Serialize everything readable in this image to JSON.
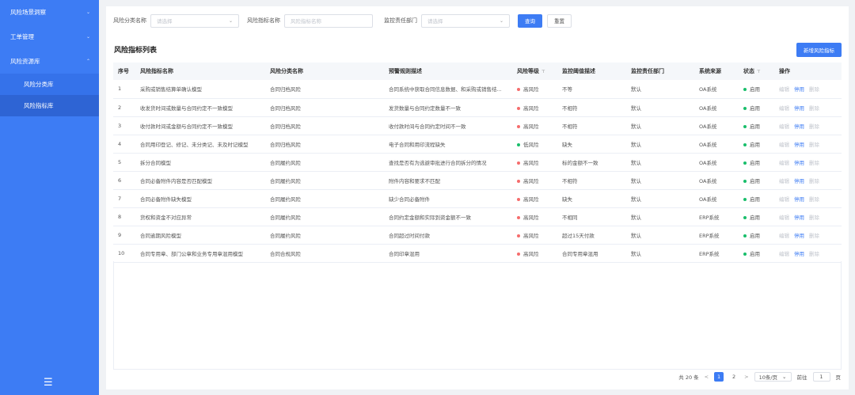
{
  "sidebar": {
    "items": [
      {
        "label": "风险场景洞察",
        "arrow": "⌄"
      },
      {
        "label": "工单管理",
        "arrow": "⌄"
      },
      {
        "label": "风险资源库",
        "arrow": "⌃"
      }
    ],
    "subitems": [
      {
        "label": "风险分类库"
      },
      {
        "label": "风险指标库"
      }
    ],
    "collapse_icon": "☰"
  },
  "filters": {
    "category_label": "风险分类名称",
    "category_placeholder": "请选择",
    "indicator_label": "风险指标名称",
    "indicator_placeholder": "风险指标名称",
    "dept_label": "监控责任部门",
    "dept_placeholder": "请选择",
    "query_button": "查询",
    "reset_button": "重置"
  },
  "section": {
    "title": "风险指标列表",
    "add_button": "新增风险指标"
  },
  "table": {
    "headers": [
      "序号",
      "风险指标名称",
      "风险分类名称",
      "预警规则描述",
      "风险等级",
      "监控阈值描述",
      "监控责任部门",
      "系统来源",
      "状态",
      "操作"
    ],
    "filter_icon": "⊤",
    "rows": [
      {
        "no": "1",
        "name": "采购或销售结算单确认模型",
        "category": "合同归档风险",
        "rule": "合同系统中获取合同信息数据、和采购或销售结...",
        "level": "高风险",
        "threshold": "不等",
        "dept": "默认",
        "source": "OA系统",
        "status": "启用"
      },
      {
        "no": "2",
        "name": "收发货时间或数量与合同约定不一致模型",
        "category": "合同归档风险",
        "rule": "发货数量与合同约定数量不一致",
        "level": "高风险",
        "threshold": "不相符",
        "dept": "默认",
        "source": "OA系统",
        "status": "启用"
      },
      {
        "no": "3",
        "name": "收付款时间或金额与合同约定不一致模型",
        "category": "合同归档风险",
        "rule": "收付款时间与合同约定时间不一致",
        "level": "高风险",
        "threshold": "不相符",
        "dept": "默认",
        "source": "OA系统",
        "status": "启用"
      },
      {
        "no": "4",
        "name": "合同用印登记、修记、未分类记、未及时记模型",
        "category": "合同归档风险",
        "rule": "电子合同和用印流程缺失",
        "level": "低风险",
        "threshold": "缺失",
        "dept": "默认",
        "source": "OA系统",
        "status": "启用"
      },
      {
        "no": "5",
        "name": "拆分合同模型",
        "category": "合同履约风险",
        "rule": "查找是否有为逃避审批进行合同拆分的情况",
        "level": "高风险",
        "threshold": "标的金额不一致",
        "dept": "默认",
        "source": "OA系统",
        "status": "启用"
      },
      {
        "no": "6",
        "name": "合同必备附件内容是否匹配模型",
        "category": "合同履约风险",
        "rule": "附件内容和要求不匹配",
        "level": "高风险",
        "threshold": "不相符",
        "dept": "默认",
        "source": "OA系统",
        "status": "启用"
      },
      {
        "no": "7",
        "name": "合同必备附件缺失模型",
        "category": "合同履约风险",
        "rule": "缺少合同必备附件",
        "level": "高风险",
        "threshold": "缺失",
        "dept": "默认",
        "source": "OA系统",
        "status": "启用"
      },
      {
        "no": "8",
        "name": "货权和资金不对应异常",
        "category": "合同履约风险",
        "rule": "合同约定金额和实际到资金额不一致",
        "level": "高风险",
        "threshold": "不相同",
        "dept": "默认",
        "source": "ERP系统",
        "status": "启用"
      },
      {
        "no": "9",
        "name": "合同逾期风险模型",
        "category": "合同履约风险",
        "rule": "合同超过时间付款",
        "level": "高风险",
        "threshold": "超过15天付款",
        "dept": "默认",
        "source": "ERP系统",
        "status": "启用"
      },
      {
        "no": "10",
        "name": "合同专用章、部门公章和业务专用章混用模型",
        "category": "合同合规风险",
        "rule": "合同印章混用",
        "level": "高风险",
        "threshold": "合同专用章混用",
        "dept": "默认",
        "source": "ERP系统",
        "status": "启用"
      }
    ],
    "ops": {
      "edit": "编辑",
      "disable": "停用",
      "delete": "删除"
    }
  },
  "pagination": {
    "total": "共 20 条",
    "prev": "<",
    "pages": [
      "1",
      "2"
    ],
    "next": ">",
    "page_size": "10条/页",
    "goto_label": "前往",
    "goto_value": "1",
    "page_unit": "页"
  },
  "colors": {
    "primary": "#3d7cf4",
    "high_risk": "#f56c6c",
    "low_risk": "#19be6b",
    "enabled": "#19be6b"
  }
}
